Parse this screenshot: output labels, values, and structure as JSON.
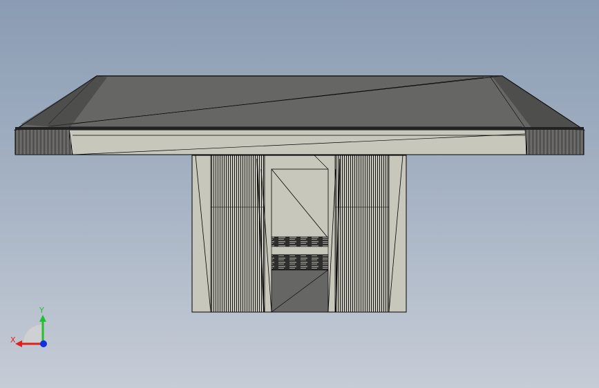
{
  "viewport": {
    "model": "cad-table-top-with-pedestal-front-view",
    "colors": {
      "background_top": "#8a9cb3",
      "background_bottom": "#c6ccd6",
      "top_face": "#666764",
      "side_face": "#c8c7bb",
      "edge": "#000000"
    }
  },
  "triad": {
    "x_label": "X",
    "y_label": "Y",
    "colors": {
      "x": "#e02020",
      "y": "#20c030",
      "z": "#1030e0"
    }
  }
}
